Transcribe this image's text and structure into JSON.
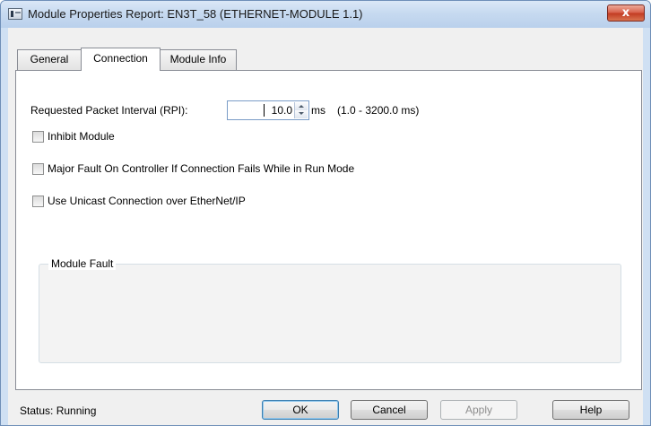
{
  "window": {
    "title": "Module Properties Report: EN3T_58 (ETHERNET-MODULE 1.1)",
    "close_label": "x",
    "app_icon": "module-icon"
  },
  "tabs": [
    {
      "label": "General",
      "active": false
    },
    {
      "label": "Connection",
      "active": true
    },
    {
      "label": "Module Info",
      "active": false
    }
  ],
  "connection": {
    "rpi_label": "Requested Packet Interval (RPI):",
    "rpi_value": "10.0",
    "rpi_unit": "ms",
    "rpi_range": "(1.0 - 3200.0 ms)",
    "checkboxes": [
      {
        "label": "Inhibit Module",
        "checked": false
      },
      {
        "label": "Major Fault On Controller If Connection Fails While in Run Mode",
        "checked": false
      },
      {
        "label": "Use Unicast Connection over EtherNet/IP",
        "checked": false
      }
    ],
    "module_fault_label": "Module Fault"
  },
  "footer": {
    "status": "Status:  Running",
    "buttons": {
      "ok": "OK",
      "cancel": "Cancel",
      "apply": "Apply",
      "help": "Help"
    }
  },
  "colors": {
    "title_bar": "#c7daf0",
    "close_button": "#c23b22",
    "dialog_bg": "#f0f0f0",
    "panel_bg": "#ffffff"
  }
}
